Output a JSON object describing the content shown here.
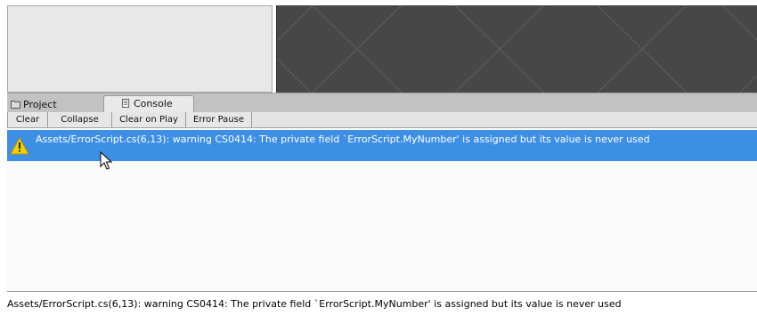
{
  "window": {
    "tabs": [
      {
        "label": "Project",
        "icon": "folder-icon",
        "active": false
      },
      {
        "label": "Console",
        "icon": "console-icon",
        "active": true
      }
    ]
  },
  "toolbar": {
    "clear_label": "Clear",
    "collapse_label": "Collapse",
    "clear_on_play_label": "Clear on Play",
    "error_pause_label": "Error Pause"
  },
  "console": {
    "entries": [
      {
        "icon": "warning-icon",
        "text": "Assets/ErrorScript.cs(6,13): warning CS0414: The private field `ErrorScript.MyNumber' is assigned but its value is never used",
        "selected": true
      }
    ],
    "detail_text": "Assets/ErrorScript.cs(6,13): warning CS0414: The private field `ErrorScript.MyNumber' is assigned but its value is never used"
  },
  "colors": {
    "selection": "#3d8fe6",
    "warning": "#f5d000",
    "scene_background": "#474747"
  }
}
